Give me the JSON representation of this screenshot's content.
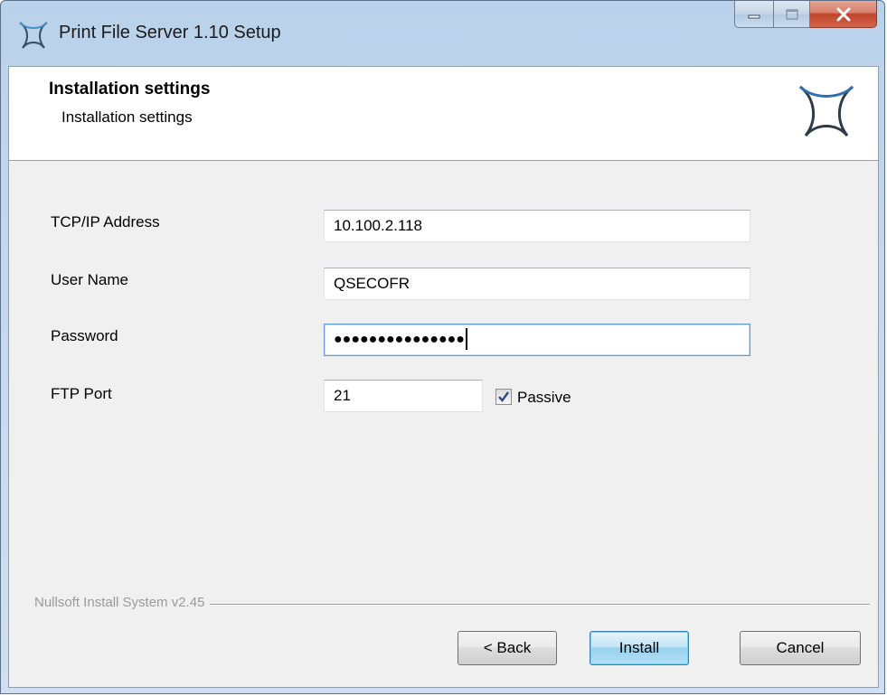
{
  "window": {
    "title": "Print File Server 1.10 Setup",
    "icon": "nsis-star-icon"
  },
  "header": {
    "title": "Installation settings",
    "subtitle": "Installation settings"
  },
  "form": {
    "tcpip_label": "TCP/IP Address",
    "tcpip_value": "10.100.2.118",
    "username_label": "User Name",
    "username_value": "QSECOFR",
    "password_label": "Password",
    "password_mask": "●●●●●●●●●●●●●●●",
    "ftp_port_label": "FTP Port",
    "ftp_port_value": "21",
    "passive_label": "Passive",
    "passive_checked": true
  },
  "footer": {
    "brand": "Nullsoft Install System v2.45"
  },
  "buttons": {
    "back": "< Back",
    "install": "Install",
    "cancel": "Cancel"
  },
  "colors": {
    "titlebar": "#c4d8ee",
    "dialog_bg": "#f0f0f0",
    "close_button": "#c2452b",
    "focus_border": "#5b9bd5",
    "default_button": "#98d1ef"
  }
}
